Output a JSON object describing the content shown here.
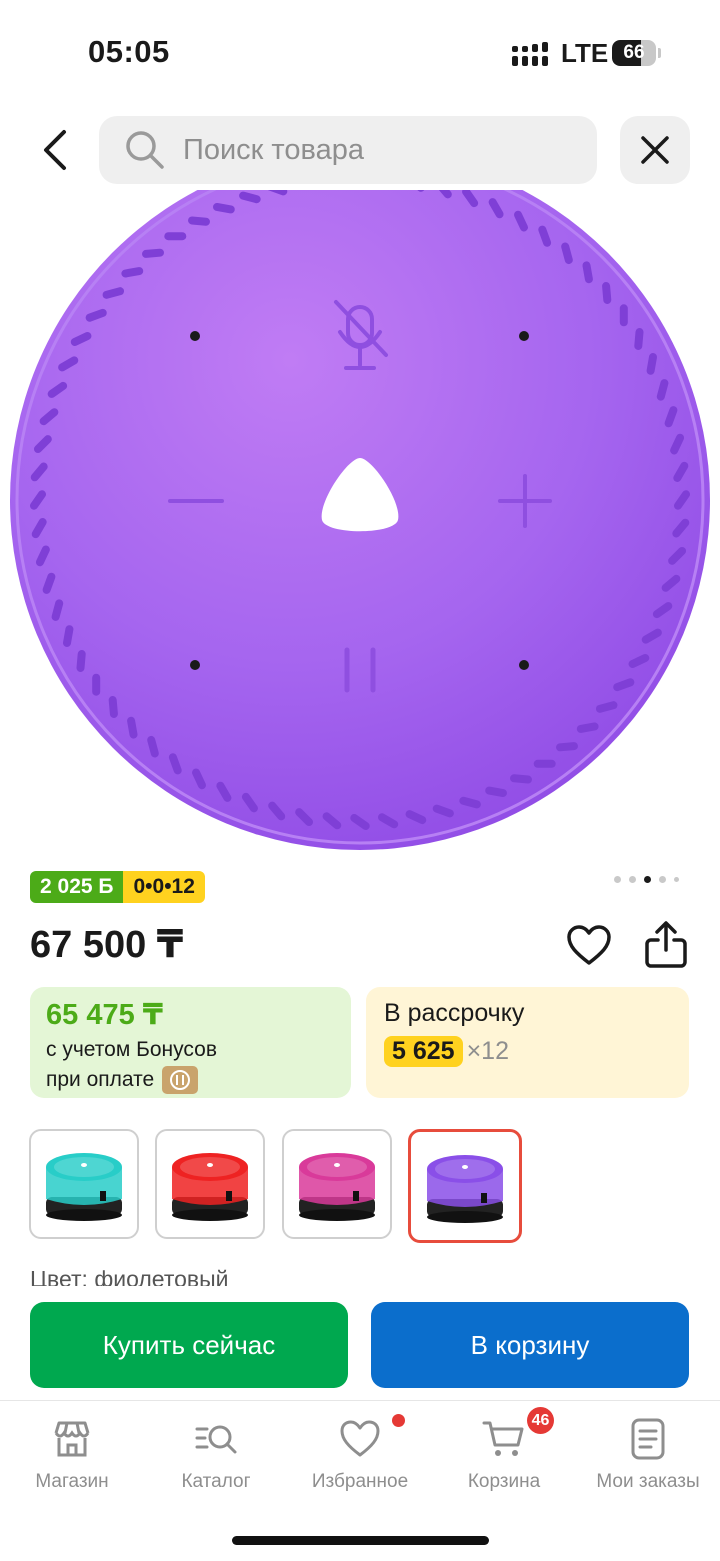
{
  "status_bar": {
    "time": "05:05",
    "network": "LTE",
    "battery_percent": "66",
    "battery_level": 0.66
  },
  "header": {
    "back_icon": "chevron-left-icon",
    "search_placeholder": "Поиск товара",
    "search_value": "",
    "search_icon": "search-icon",
    "close_icon": "close-icon"
  },
  "gallery": {
    "image_count": 5,
    "active_index": 2
  },
  "badges": {
    "bonus": "2 025 Б",
    "installment": "0•0•12"
  },
  "product": {
    "price": "67 500 ₸",
    "favorite_icon": "heart-icon",
    "share_icon": "share-icon"
  },
  "bonus_card": {
    "amount": "65 475 ₸",
    "line1": "с учетом Бонусов",
    "line2": "при оплате"
  },
  "installment_card": {
    "title": "В рассрочку",
    "monthly": "5 625",
    "months": "×12"
  },
  "variants": [
    {
      "name": "turquoise",
      "color": "#28cdc8"
    },
    {
      "name": "red",
      "color": "#ee2222"
    },
    {
      "name": "pink",
      "color": "#d93a9a"
    },
    {
      "name": "purple",
      "color": "#8a4fe8",
      "selected": true
    }
  ],
  "color_label": "Цвет: фиолетовый",
  "actions": {
    "buy_now": "Купить сейчас",
    "add_to_cart": "В корзину"
  },
  "tabs": [
    {
      "label": "Магазин",
      "icon": "store-icon"
    },
    {
      "label": "Каталог",
      "icon": "catalog-search-icon"
    },
    {
      "label": "Избранное",
      "icon": "heart-icon"
    },
    {
      "label": "Корзина",
      "icon": "cart-icon"
    },
    {
      "label": "Мои заказы",
      "icon": "orders-icon"
    }
  ],
  "cart_count": "46",
  "colors": {
    "bonus_green": "#4cab18",
    "installment_yellow": "#ffd21f",
    "buy_green": "#00a84f",
    "cart_blue": "#0b6ecc",
    "badge_red": "#e53935",
    "speaker_purple": "#a768ef"
  }
}
